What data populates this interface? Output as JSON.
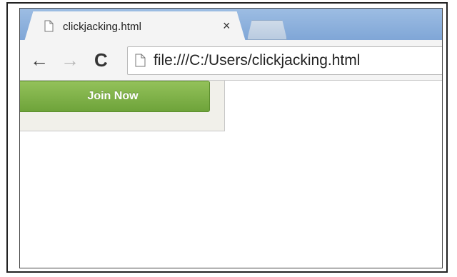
{
  "tab": {
    "title": "clickjacking.html",
    "close_glyph": "×",
    "icon": "page-icon"
  },
  "toolbar": {
    "back_glyph": "←",
    "forward_glyph": "→",
    "reload_glyph": "C",
    "address": "file:///C:/Users/clickjacking.html",
    "address_icon": "page-icon"
  },
  "content": {
    "join_button_label": "Join Now"
  },
  "colors": {
    "tabstrip": "#8fb2de",
    "join_button": "#7fb248"
  }
}
